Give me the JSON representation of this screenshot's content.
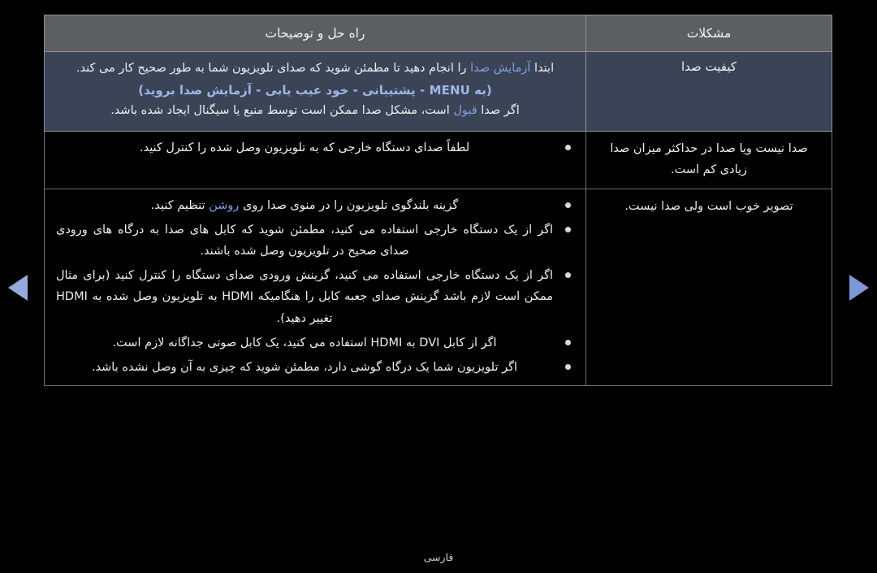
{
  "nav": {
    "prev_label": "◀",
    "next_label": "▶"
  },
  "footer": {
    "language": "فارسی"
  },
  "table": {
    "headers": {
      "solution": "راه حل و توضیحات",
      "problem": "مشکلات"
    },
    "rows": [
      {
        "problem": "کیفیت صدا",
        "highlighted": true,
        "lines": [
          {
            "kind": "text",
            "pre": "ابتدا ",
            "highlight": "آزمایش صدا",
            "post": " را انجام دهید تا مطمئن شوید که صدای تلویزیون شما به طور صحیح کار می کند."
          },
          {
            "kind": "menu",
            "text": "(به MENU - پشتیبانی - خود عیب یابی - آزمایش صدا بروید)"
          },
          {
            "kind": "text",
            "pre": "اگر صدا ",
            "highlight": "قبول",
            "post": " است، مشکل صدا ممکن است توسط منبع یا سیگنال ایجاد شده باشد."
          }
        ]
      },
      {
        "problem": "صدا نیست ویا صدا در حداکثر میزان صدا زیادی کم است.",
        "highlighted": false,
        "bullets": [
          {
            "pre": "لطفاً صدای دستگاه خارجی که به تلویزیون وصل شده را کنترل کنید.",
            "highlight": "",
            "post": ""
          }
        ]
      },
      {
        "problem": "تصویر خوب است ولی صدا نیست.",
        "highlighted": false,
        "bullets": [
          {
            "pre": "گزینه بلندگوی تلویزیون را در منوی صدا روی ",
            "highlight": "روشن",
            "post": " تنظیم کنید."
          },
          {
            "pre": "اگر از یک دستگاه خارجی استفاده می کنید، مطمئن شوید که کابل های صدا به درگاه های ورودی صدای صحیح در تلویزیون وصل شده باشند.",
            "highlight": "",
            "post": ""
          },
          {
            "pre": "اگر از یک دستگاه خارجی استفاده می کنید، گزینش ورودی صدای دستگاه را کنترل کنید (برای مثال ممکن است لازم باشد گزینش صدای جعبه کابل را هنگامیکه HDMI به تلویزیون وصل شده به HDMI تغییر دهید).",
            "highlight": "",
            "post": ""
          },
          {
            "pre": "اگر از کابل DVI به HDMI استفاده می کنید، یک کابل صوتی جداگانه لازم است.",
            "highlight": "",
            "post": ""
          },
          {
            "pre": "اگر تلویزیون شما یک درگاه گوشی دارد، مطمئن شوید که چیزی به آن وصل نشده باشد.",
            "highlight": "",
            "post": ""
          }
        ]
      }
    ]
  },
  "colors": {
    "background": "#000000",
    "header_bg": "#5d5e62",
    "highlight_row_bg": "#3b4357",
    "accent_blue": "#7f9fe0",
    "menu_blue": "#9fb6e8",
    "arrow_blue": "#94aada",
    "border": "#8e9199"
  }
}
